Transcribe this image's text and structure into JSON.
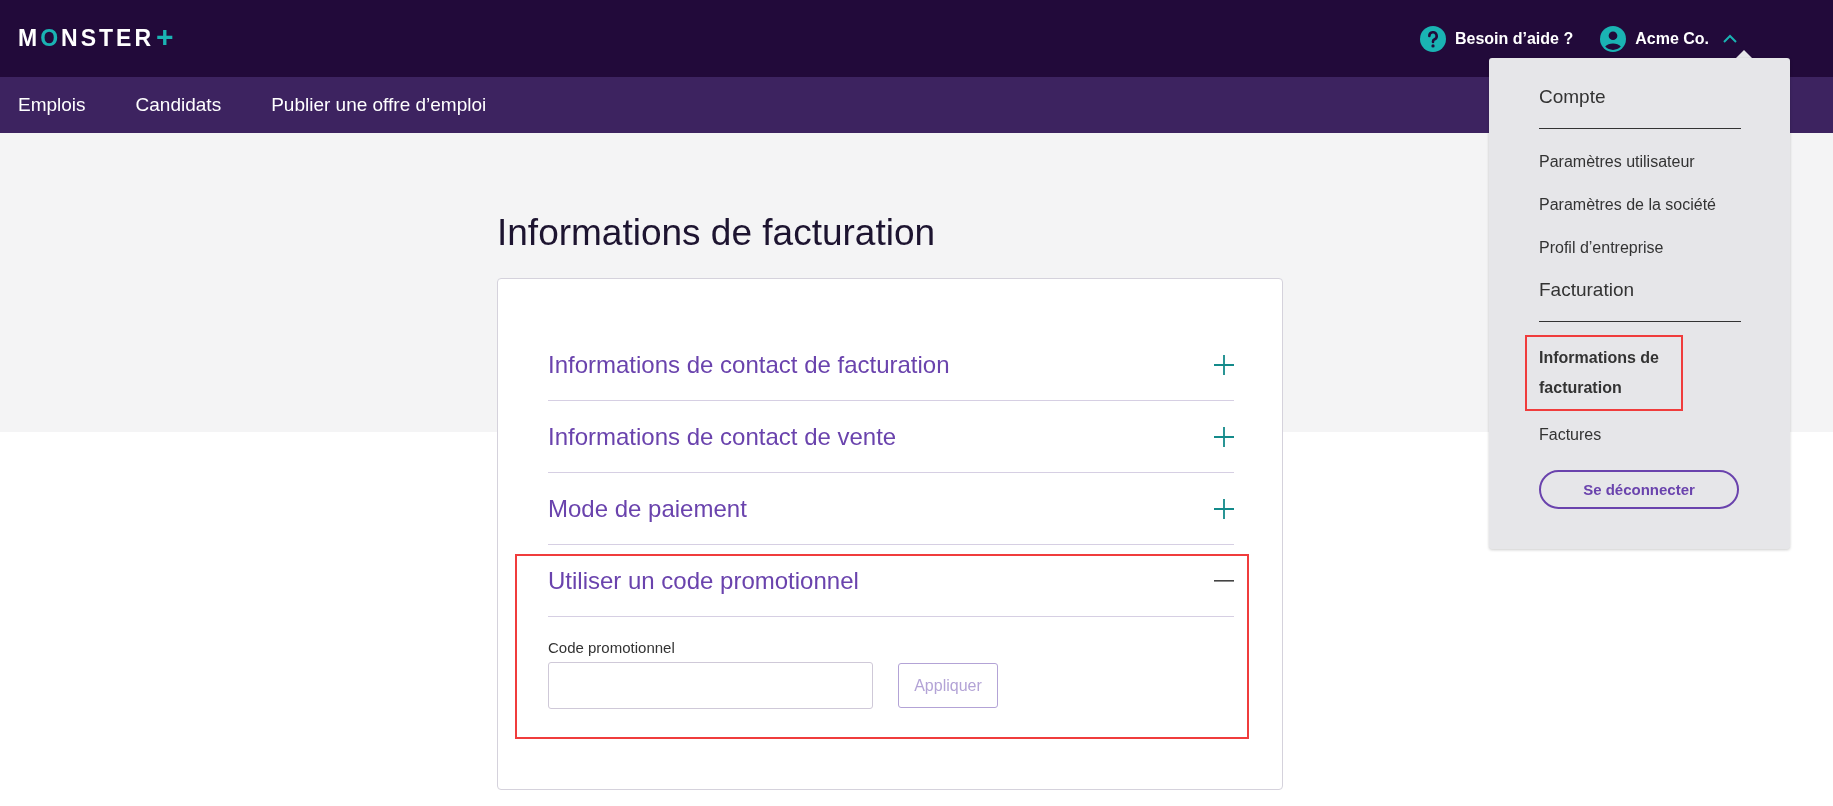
{
  "header": {
    "logo": {
      "before": "M",
      "accent": "O",
      "after": "NSTER",
      "mark": "+"
    },
    "help": {
      "label": "Besoin d’aide ?"
    },
    "account": {
      "label": "Acme Co.",
      "expanded": true
    }
  },
  "nav": [
    {
      "label": "Emplois"
    },
    {
      "label": "Candidats"
    },
    {
      "label": "Publier une offre d’emploi"
    }
  ],
  "page": {
    "title": "Informations de facturation"
  },
  "sections": [
    {
      "title": "Informations de contact de facturation",
      "expanded": false,
      "highlighted": false
    },
    {
      "title": "Informations de contact de vente",
      "expanded": false,
      "highlighted": false
    },
    {
      "title": "Mode de paiement",
      "expanded": false,
      "highlighted": false
    },
    {
      "title": "Utiliser un code promotionnel",
      "expanded": true,
      "highlighted": true,
      "field_label": "Code promotionnel",
      "button": {
        "label": "Appliquer",
        "disabled": true
      }
    }
  ],
  "menu": {
    "groups": [
      {
        "heading": "Compte",
        "items": [
          {
            "label": "Paramètres utilisateur",
            "highlighted": false
          },
          {
            "label": "Paramètres de la société",
            "highlighted": false
          },
          {
            "label": "Profil d’entreprise",
            "highlighted": false
          }
        ]
      },
      {
        "heading": "Facturation",
        "items": [
          {
            "label": "Informations de facturation",
            "highlighted": true
          },
          {
            "label": "Factures",
            "highlighted": false
          }
        ]
      }
    ],
    "logout": "Se déconnecter"
  }
}
